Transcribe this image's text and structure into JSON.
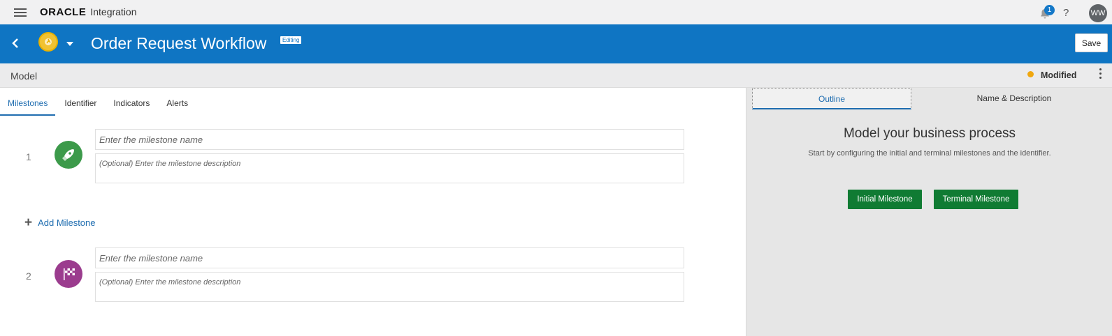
{
  "topbar": {
    "brand": "ORACLE",
    "product": "Integration",
    "notifications_count": "1",
    "help_label": "?",
    "avatar_initials": "WW"
  },
  "header": {
    "title": "Order Request Workflow",
    "badge": "Editing",
    "save_label": "Save"
  },
  "modelbar": {
    "label": "Model",
    "status": "Modified"
  },
  "tabs": [
    {
      "label": "Milestones",
      "active": true
    },
    {
      "label": "Identifier",
      "active": false
    },
    {
      "label": "Indicators",
      "active": false
    },
    {
      "label": "Alerts",
      "active": false
    }
  ],
  "milestones": [
    {
      "number": "1",
      "icon": "rocket-icon",
      "name_placeholder": "Enter the milestone name",
      "desc_placeholder": "(Optional) Enter the milestone description"
    },
    {
      "number": "2",
      "icon": "checkered-flag-icon",
      "name_placeholder": "Enter the milestone name",
      "desc_placeholder": "(Optional) Enter the milestone description"
    }
  ],
  "add_milestone_label": "Add Milestone",
  "right_panel": {
    "tabs": [
      {
        "label": "Outline",
        "active": true
      },
      {
        "label": "Name & Description",
        "active": false
      }
    ],
    "heading": "Model your business process",
    "subtext": "Start by configuring the initial and terminal milestones and the identifier.",
    "initial_button": "Initial Milestone",
    "terminal_button": "Terminal Milestone"
  },
  "colors": {
    "header_blue": "#0f75c3",
    "accent_blue": "#1f6db0",
    "action_green": "#107b33",
    "status_orange": "#f0a70f",
    "start_green": "#3c9a4a",
    "end_purple": "#9b3c8e"
  }
}
